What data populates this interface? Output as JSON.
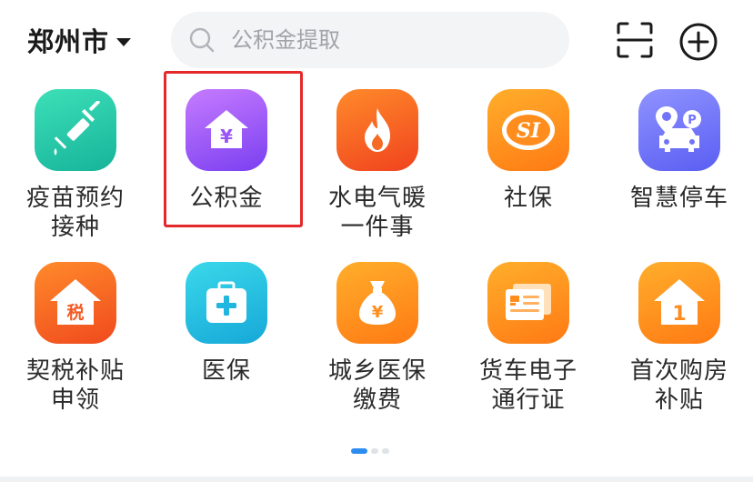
{
  "header": {
    "city": "郑州市",
    "search_placeholder": "公积金提取"
  },
  "services": [
    {
      "label": "疫苗预约\n接种",
      "icon": "syringe-icon",
      "gradient": [
        "#3de0b8",
        "#16b39a"
      ]
    },
    {
      "label": "公积金",
      "icon": "house-yuan-icon",
      "gradient": [
        "#c67bff",
        "#7a3ff0"
      ],
      "highlighted": true
    },
    {
      "label": "水电气暖\n一件事",
      "icon": "flame-icon",
      "gradient": [
        "#ff8a2a",
        "#f0431e"
      ]
    },
    {
      "label": "社保",
      "icon": "social-security-icon",
      "gradient": [
        "#ffae2b",
        "#ff7a14"
      ],
      "badge_text": "SI"
    },
    {
      "label": "智慧停车",
      "icon": "smart-parking-icon",
      "gradient": [
        "#8f93ff",
        "#5a5ef2"
      ],
      "badge_text": "P"
    },
    {
      "label": "契税补贴\n申领",
      "icon": "tax-house-icon",
      "gradient": [
        "#ff8a2a",
        "#f04a1e"
      ],
      "badge_text": "税"
    },
    {
      "label": "医保",
      "icon": "medical-kit-icon",
      "gradient": [
        "#3ad8ea",
        "#16a8d8"
      ]
    },
    {
      "label": "城乡医保\n缴费",
      "icon": "money-bag-icon",
      "gradient": [
        "#ffae2b",
        "#ff7a14"
      ]
    },
    {
      "label": "货车电子\n通行证",
      "icon": "truck-pass-icon",
      "gradient": [
        "#ffae2b",
        "#ff7a14"
      ]
    },
    {
      "label": "首次购房\n补贴",
      "icon": "first-house-icon",
      "gradient": [
        "#ffae2b",
        "#ff7a14"
      ],
      "badge_text": "1"
    }
  ],
  "pager": {
    "pages": 3,
    "current": 1
  },
  "colors": {
    "highlight_border": "#e5282a",
    "pager_active": "#2d8cf0"
  }
}
